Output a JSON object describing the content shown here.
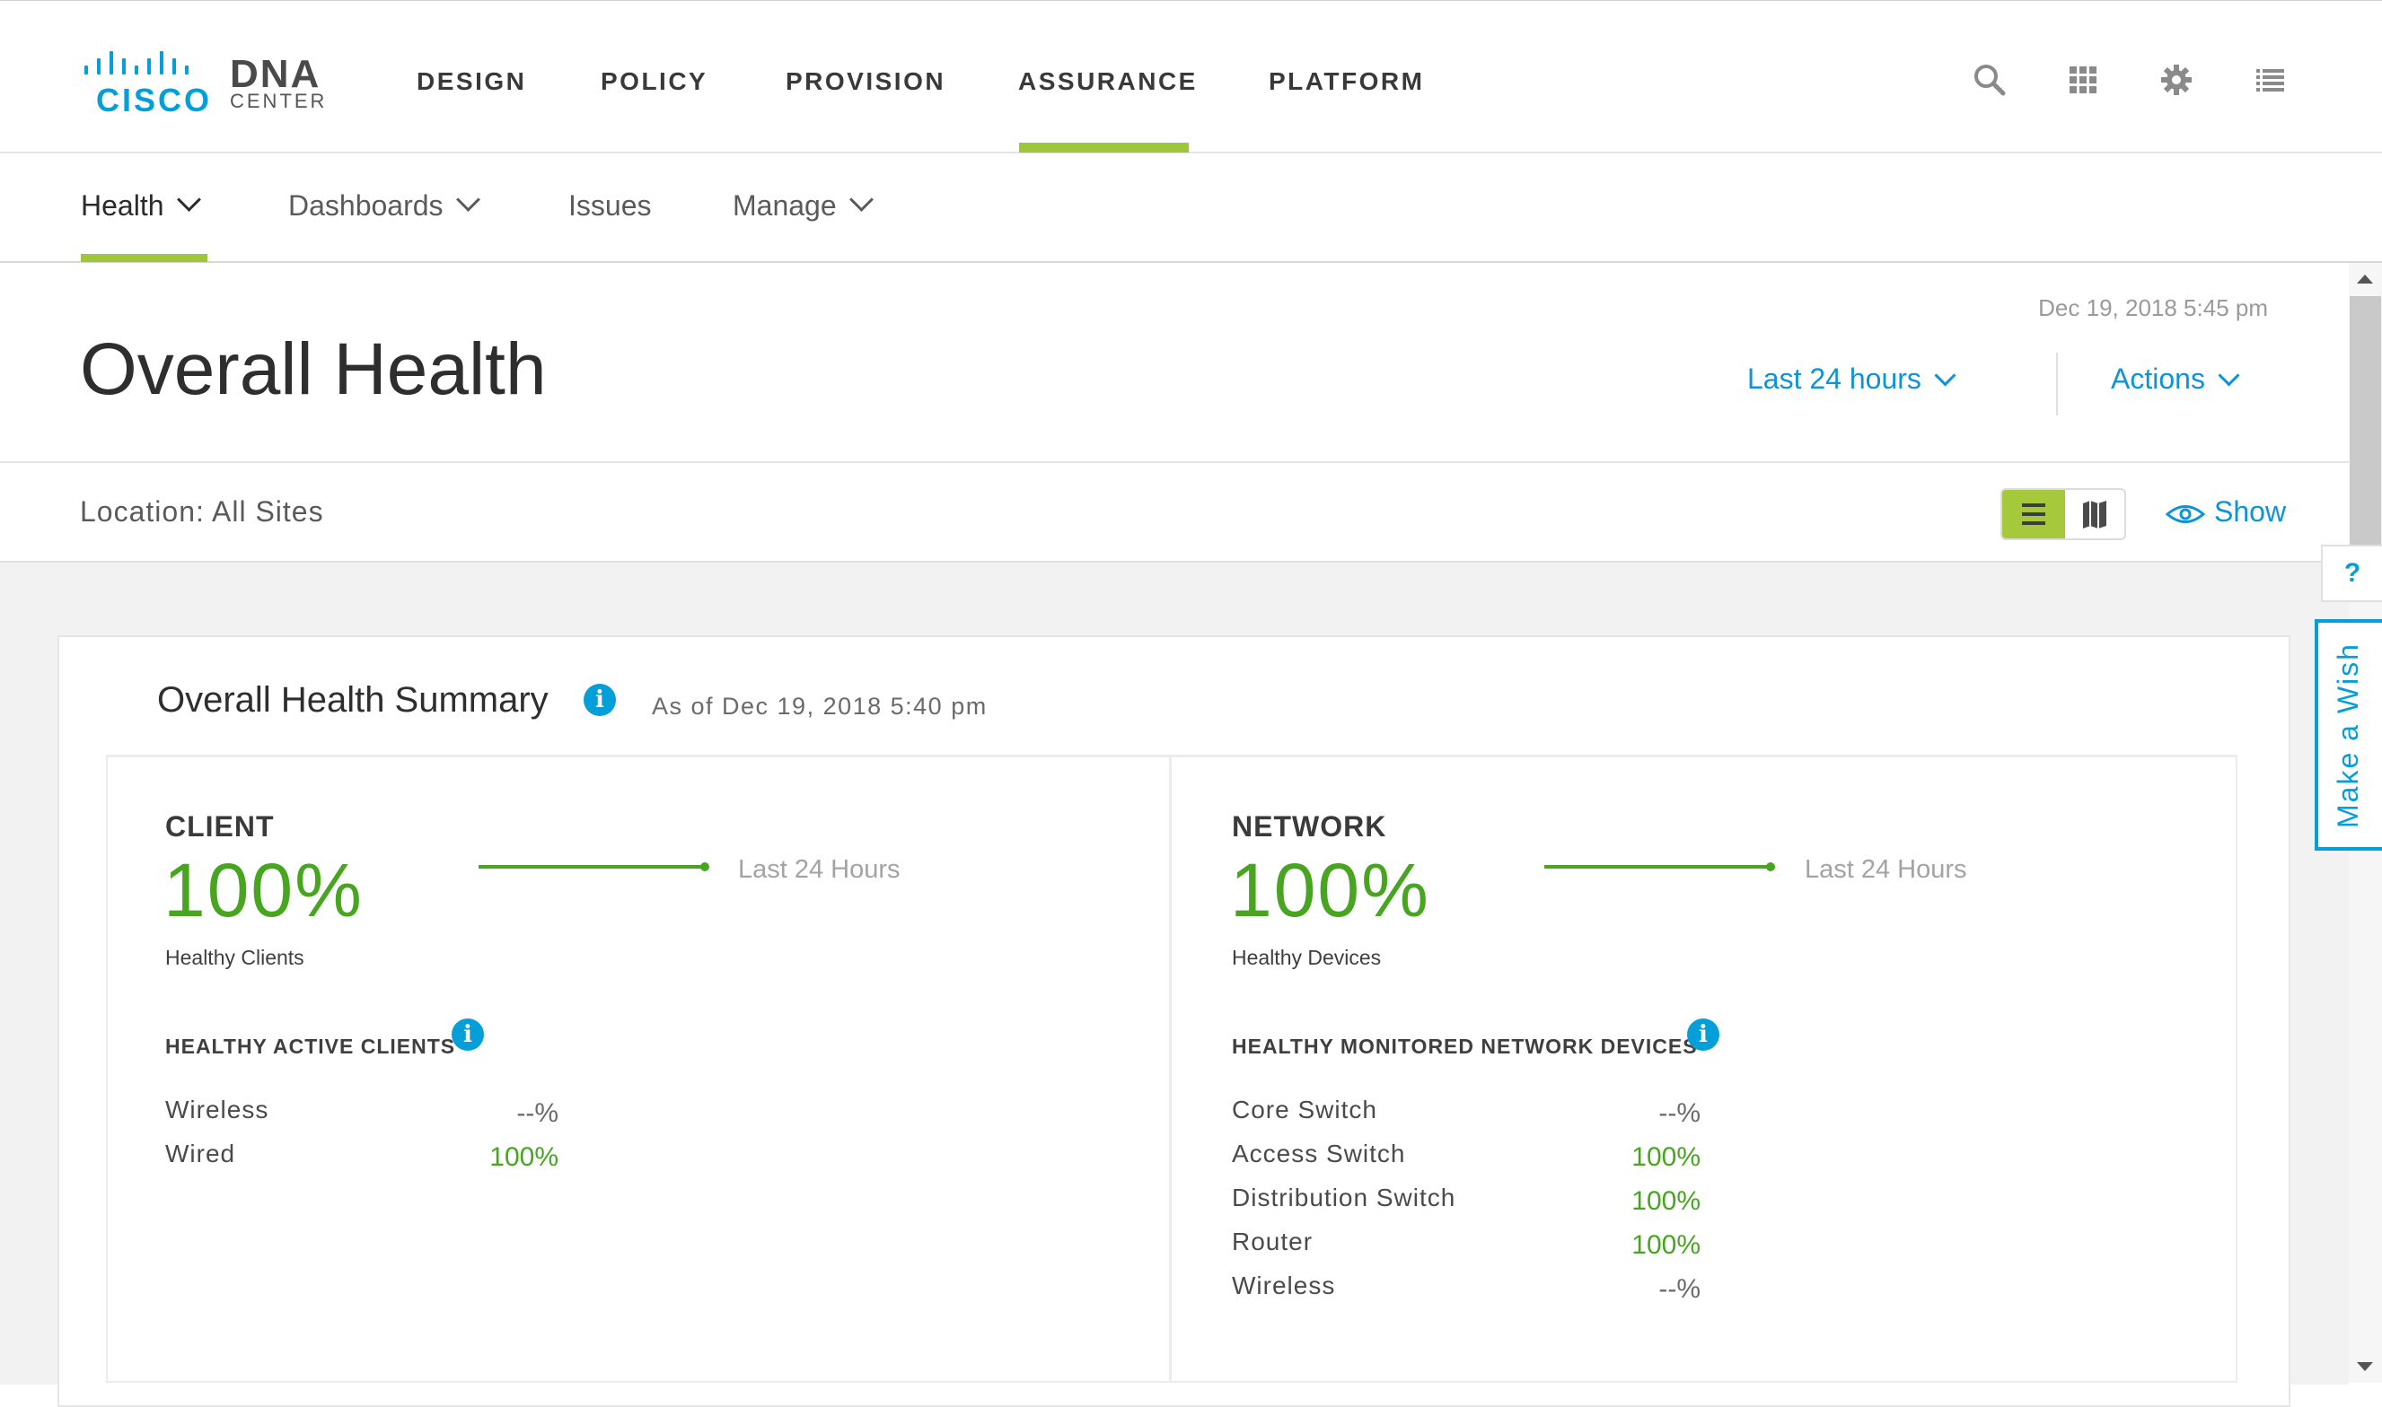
{
  "brand": {
    "cisco": "CISCO",
    "dna": "DNA",
    "center": "CENTER"
  },
  "topnav": {
    "items": [
      "DESIGN",
      "POLICY",
      "PROVISION",
      "ASSURANCE",
      "PLATFORM"
    ],
    "active": "ASSURANCE",
    "icons": [
      "search-icon",
      "apps-grid-icon",
      "gear-icon",
      "list-icon"
    ]
  },
  "subnav": {
    "items": [
      {
        "label": "Health",
        "has_dropdown": true
      },
      {
        "label": "Dashboards",
        "has_dropdown": true
      },
      {
        "label": "Issues",
        "has_dropdown": false
      },
      {
        "label": "Manage",
        "has_dropdown": true
      }
    ],
    "active": "Health"
  },
  "header": {
    "title": "Overall Health",
    "timestamp": "Dec 19, 2018 5:45 pm",
    "time_range": "Last 24 hours",
    "actions": "Actions"
  },
  "location": {
    "text": "Location: All Sites",
    "view_mode": "list",
    "show": "Show"
  },
  "summary": {
    "title": "Overall Health Summary",
    "as_of": "As of Dec 19, 2018 5:40 pm",
    "client": {
      "title": "CLIENT",
      "percent": "100%",
      "label": "Healthy Clients",
      "trend_label": "Last 24 Hours",
      "list_title": "HEALTHY ACTIVE CLIENTS",
      "rows": [
        {
          "label": "Wireless",
          "value": "--%"
        },
        {
          "label": "Wired",
          "value": "100%"
        }
      ]
    },
    "network": {
      "title": "NETWORK",
      "percent": "100%",
      "label": "Healthy Devices",
      "trend_label": "Last 24 Hours",
      "list_title": "HEALTHY MONITORED NETWORK DEVICES",
      "rows": [
        {
          "label": "Core Switch",
          "value": "--%"
        },
        {
          "label": "Access Switch",
          "value": "100%"
        },
        {
          "label": "Distribution Switch",
          "value": "100%"
        },
        {
          "label": "Router",
          "value": "100%"
        },
        {
          "label": "Wireless",
          "value": "--%"
        }
      ]
    }
  },
  "side": {
    "help": "?",
    "wish": "Make a Wish"
  },
  "colors": {
    "accent": "#9ec63b",
    "link": "#049fd9",
    "healthy": "#47a51f"
  }
}
